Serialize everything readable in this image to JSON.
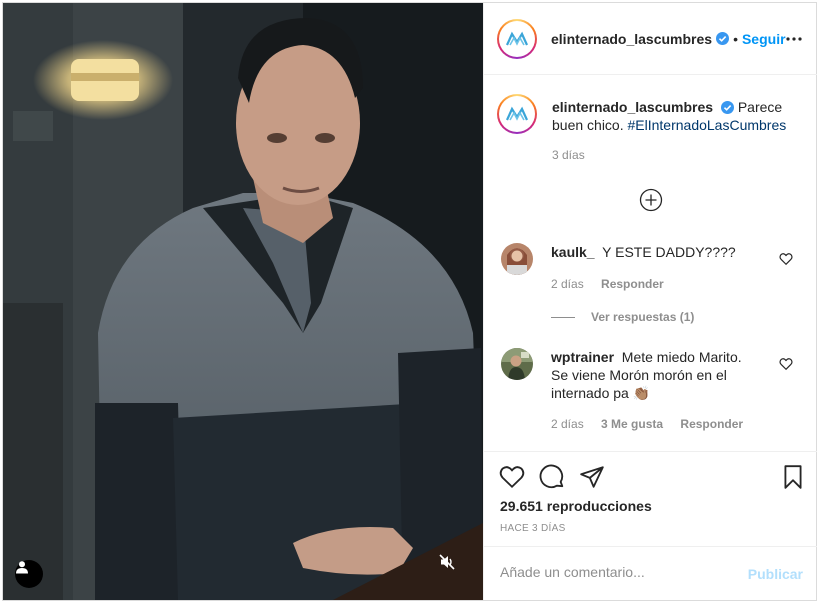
{
  "post": {
    "username": "elinternado_lascumbres",
    "follow_label": "Seguir",
    "separator": "•",
    "caption": {
      "username": "elinternado_lascumbres",
      "text": "Parece buen chico.",
      "hashtag": "#ElInternadoLasCumbres",
      "time": "3 días"
    },
    "comments": [
      {
        "username": "kaulk_",
        "text": "Y ESTE DADDY????",
        "time": "2 días",
        "reply_label": "Responder",
        "view_replies": "Ver respuestas (1)"
      },
      {
        "username": "wptrainer",
        "text": "Mete miedo Marito. Se viene Morón morón en el internado pa",
        "emoji": "👏🏽",
        "time": "2 días",
        "likes": "3 Me gusta",
        "reply_label": "Responder"
      }
    ],
    "views": "29.651 reproducciones",
    "date": "HACE 3 DÍAS",
    "add_comment": {
      "placeholder": "Añade un comentario...",
      "publish_label": "Publicar"
    }
  },
  "icons": {
    "verified": "verified-badge-icon",
    "more": "more-options-icon",
    "load_more": "load-more-comments-icon",
    "heart": "heart-icon",
    "comment": "comment-icon",
    "share": "share-icon",
    "save": "bookmark-icon",
    "mute": "mute-icon",
    "user_tag": "user-tag-icon"
  },
  "colors": {
    "accent": "#0095f6",
    "hashtag": "#00376b",
    "muted": "#8e8e8e",
    "publish_disabled": "#b2dffc"
  }
}
